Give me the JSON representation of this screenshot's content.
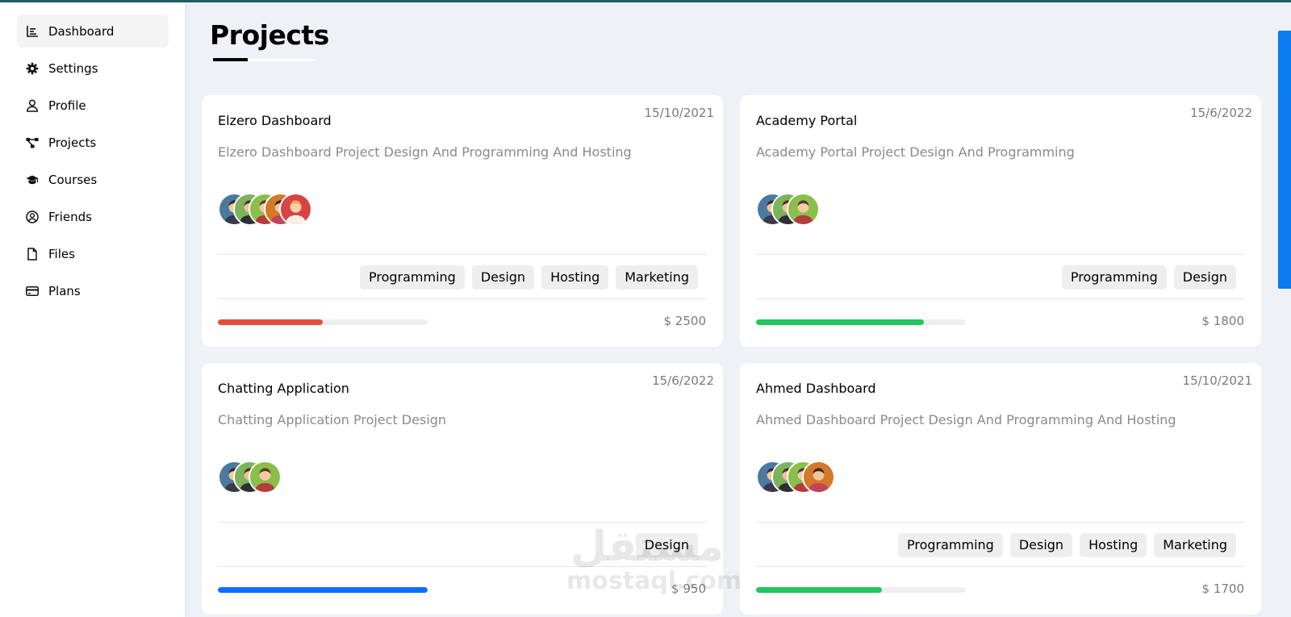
{
  "sidebar": {
    "items": [
      {
        "label": "Dashboard",
        "icon": "chart-icon",
        "active": true
      },
      {
        "label": "Settings",
        "icon": "gear-icon"
      },
      {
        "label": "Profile",
        "icon": "user-icon"
      },
      {
        "label": "Projects",
        "icon": "diagram-icon"
      },
      {
        "label": "Courses",
        "icon": "graduation-cap-icon"
      },
      {
        "label": "Friends",
        "icon": "user-circle-icon"
      },
      {
        "label": "Files",
        "icon": "file-icon"
      },
      {
        "label": "Plans",
        "icon": "credit-card-icon"
      }
    ]
  },
  "page": {
    "title": "Projects"
  },
  "projects": [
    {
      "title": "Elzero Dashboard",
      "date": "15/10/2021",
      "description": "Elzero Dashboard Project Design And Programming And Hosting",
      "tags": [
        "Programming",
        "Design",
        "Hosting",
        "Marketing"
      ],
      "progress": 0.5,
      "progress_color": "#e74c3c",
      "price": "$ 2500",
      "avatar_count": 5
    },
    {
      "title": "Academy Portal",
      "date": "15/6/2022",
      "description": "Academy Portal Project Design And Programming",
      "tags": [
        "Programming",
        "Design"
      ],
      "progress": 0.8,
      "progress_color": "#22c55e",
      "price": "$ 1800",
      "avatar_count": 3
    },
    {
      "title": "Chatting Application",
      "date": "15/6/2022",
      "description": "Chatting Application Project Design",
      "tags": [
        "Design"
      ],
      "progress": 1.0,
      "progress_color": "#0d6efd",
      "price": "$ 950",
      "avatar_count": 3
    },
    {
      "title": "Ahmed Dashboard",
      "date": "15/10/2021",
      "description": "Ahmed Dashboard Project Design And Programming And Hosting",
      "tags": [
        "Programming",
        "Design",
        "Hosting",
        "Marketing"
      ],
      "progress": 0.6,
      "progress_color": "#22c55e",
      "price": "$ 1700",
      "avatar_count": 4
    }
  ],
  "watermark": {
    "arabic": "مستقل",
    "latin": "mostaql.com"
  },
  "colors": {
    "accent": "#0d7bf0",
    "background": "#eef1f5"
  }
}
